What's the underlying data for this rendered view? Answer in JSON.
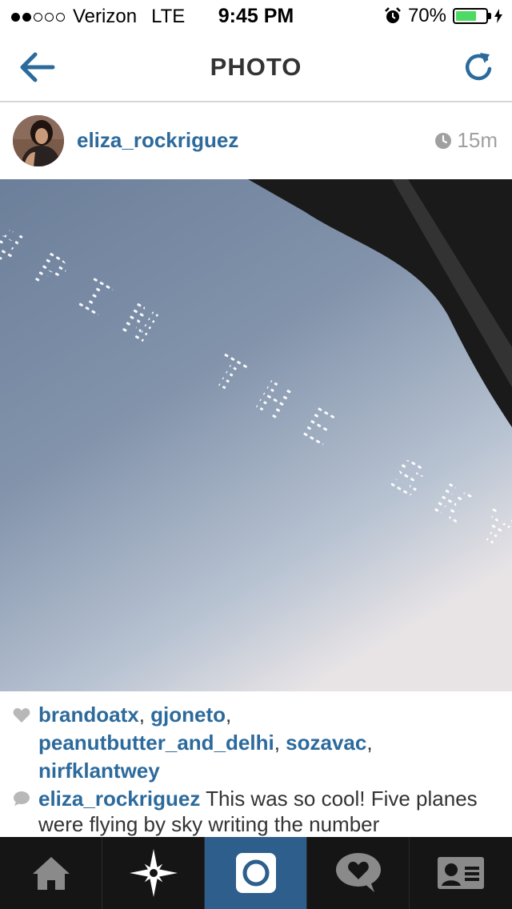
{
  "status_bar": {
    "carrier": "Verizon",
    "network": "LTE",
    "time": "9:45 PM",
    "battery_percent": "70%",
    "battery_level": 0.7,
    "signal_bars_filled": 2,
    "signal_bars_total": 5
  },
  "nav": {
    "title": "PHOTO",
    "back_icon": "back-arrow-icon",
    "refresh_icon": "refresh-icon"
  },
  "post": {
    "username": "eliza_rockriguez",
    "time_ago": "15m",
    "photo_text": "#PIN THE SKY",
    "likes": [
      "brandoatx",
      "gjoneto",
      "peanutbutter_and_delhi",
      "sozavac",
      "nirfklantwey"
    ],
    "comment": {
      "username": "eliza_rockriguez",
      "text": "This was so cool! Five planes were flying by sky writing the number"
    }
  },
  "tabs": [
    {
      "name": "home",
      "icon": "home-icon"
    },
    {
      "name": "explore",
      "icon": "explore-star-icon"
    },
    {
      "name": "camera",
      "icon": "camera-icon"
    },
    {
      "name": "activity",
      "icon": "heart-bubble-icon"
    },
    {
      "name": "profile",
      "icon": "profile-card-icon"
    }
  ],
  "colors": {
    "accent": "#2c6a9c",
    "active_tab": "#2e5f8c",
    "tabbar": "#151515",
    "battery": "#4cd964"
  }
}
